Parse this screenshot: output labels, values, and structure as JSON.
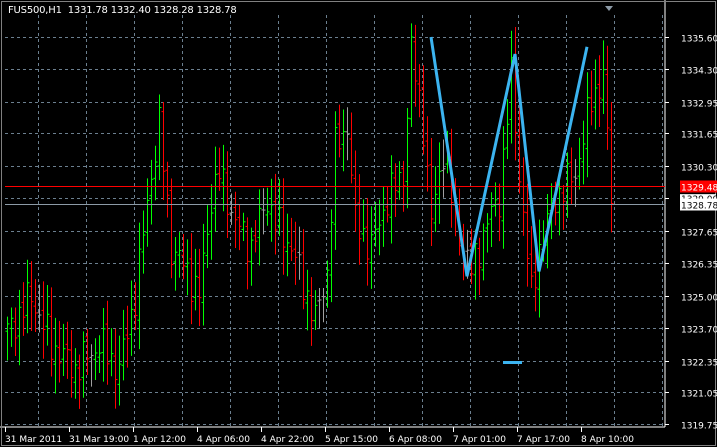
{
  "header": {
    "symbol": "FUS500,H1",
    "open": "1331.78",
    "high": "1332.40",
    "low": "1328.28",
    "close": "1328.78"
  },
  "colors": {
    "up": "#00ff00",
    "down": "#ff0000",
    "neutral": "#a0a0a0",
    "grid": "#6b7f8f",
    "bid_line": "#ff0000",
    "close_line": "#8c9aa6",
    "drawing": "#3cb4f0"
  },
  "chart_data": {
    "type": "ohlc",
    "ylim": [
      1319.75,
      1335.6
    ],
    "y_ticks": [
      "1335.60",
      "1334.30",
      "1332.95",
      "1331.65",
      "1330.30",
      "1329.00",
      "1327.65",
      "1326.35",
      "1325.00",
      "1323.70",
      "1322.35",
      "1321.05",
      "1319.75"
    ],
    "x_ticks": [
      "31 Mar 2011",
      "31 Mar 19:00",
      "1 Apr 12:00",
      "4 Apr 06:00",
      "4 Apr 22:00",
      "5 Apr 15:00",
      "6 Apr 08:00",
      "7 Apr 01:00",
      "7 Apr 17:00",
      "8 Apr 10:00"
    ],
    "bars_per_tick": 16,
    "close_anchors": [
      [
        0,
        1323.5
      ],
      [
        6,
        1325
      ],
      [
        11,
        1323
      ],
      [
        17,
        1322
      ],
      [
        23,
        1323
      ],
      [
        28,
        1322
      ],
      [
        32,
        1325
      ],
      [
        36,
        1330
      ],
      [
        38,
        1332
      ],
      [
        41,
        1327
      ],
      [
        45,
        1326
      ],
      [
        48,
        1325
      ],
      [
        51,
        1329
      ],
      [
        53,
        1330
      ],
      [
        57,
        1328
      ],
      [
        61,
        1327
      ],
      [
        65,
        1329
      ],
      [
        67,
        1328
      ],
      [
        71,
        1327
      ],
      [
        75,
        1325
      ],
      [
        77,
        1324
      ],
      [
        80,
        1326
      ],
      [
        82,
        1331
      ],
      [
        85,
        1332
      ],
      [
        87,
        1328
      ],
      [
        91,
        1327
      ],
      [
        95,
        1329
      ],
      [
        99,
        1330
      ],
      [
        101,
        1335
      ],
      [
        104,
        1332
      ],
      [
        106,
        1328
      ],
      [
        109,
        1331
      ],
      [
        112,
        1328
      ],
      [
        116,
        1326
      ],
      [
        120,
        1328
      ],
      [
        123,
        1329
      ],
      [
        126,
        1334
      ],
      [
        128,
        1330
      ],
      [
        131,
        1325
      ],
      [
        133,
        1327
      ],
      [
        137,
        1329
      ],
      [
        142,
        1330
      ],
      [
        146,
        1333
      ],
      [
        149,
        1334
      ],
      [
        151,
        1328.78
      ]
    ],
    "bid_price": "1329.48",
    "last_price": "1328.78",
    "hidden_label": "1329.00",
    "zigzag": [
      [
        106,
        1335.6
      ],
      [
        115,
        1325.8
      ],
      [
        127,
        1334.9
      ],
      [
        133,
        1326.0
      ],
      [
        145,
        1335.2
      ]
    ],
    "marker_level": 1322.35
  }
}
